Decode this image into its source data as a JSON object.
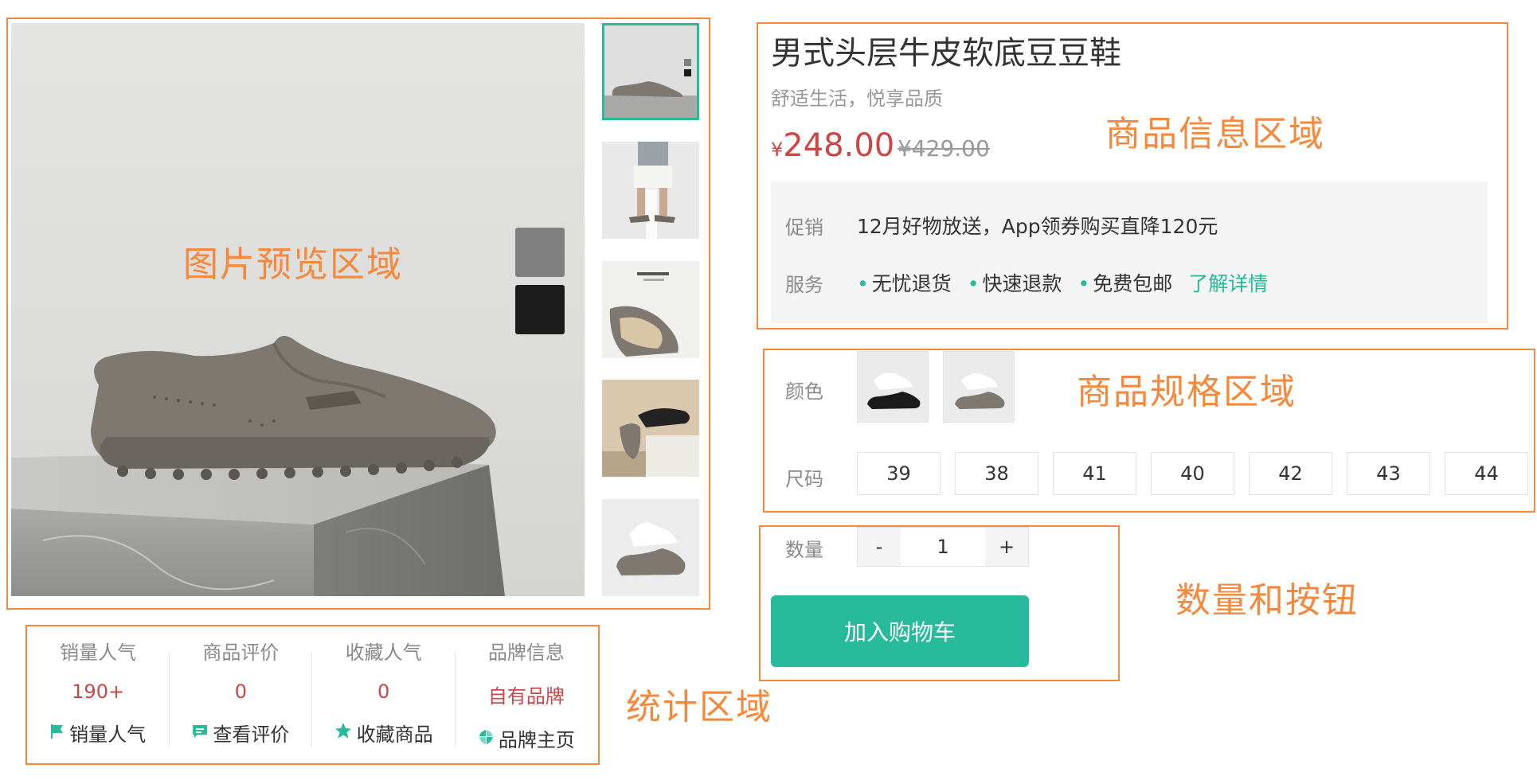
{
  "preview": {
    "annotation": "图片预览区域"
  },
  "info": {
    "title": "男式头层牛皮软底豆豆鞋",
    "subtitle": "舒适生活，悦享品质",
    "price_symbol": "¥",
    "price": "248.00",
    "old_price": "¥429.00",
    "annotation": "商品信息区域",
    "promo_label": "促销",
    "promo_text": "12月好物放送，App领券购买直降120元",
    "service_label": "服务",
    "services": [
      "无忧退货",
      "快速退款",
      "免费包邮"
    ],
    "service_link": "了解详情"
  },
  "spec": {
    "annotation": "商品规格区域",
    "color_label": "颜色",
    "size_label": "尺码",
    "sizes": [
      "39",
      "38",
      "41",
      "40",
      "42",
      "43",
      "44"
    ]
  },
  "quantity": {
    "annotation": "数量和按钮",
    "label": "数量",
    "minus": "-",
    "value": "1",
    "plus": "+",
    "cart_button": "加入购物车"
  },
  "stats": {
    "annotation": "统计区域",
    "columns": [
      {
        "title": "销量人气",
        "value": "190+",
        "action": "销量人气",
        "icon": "flag-icon"
      },
      {
        "title": "商品评价",
        "value": "0",
        "action": "查看评价",
        "icon": "comment-icon"
      },
      {
        "title": "收藏人气",
        "value": "0",
        "action": "收藏商品",
        "icon": "star-icon"
      },
      {
        "title": "品牌信息",
        "value": "自有品牌",
        "action": "品牌主页",
        "icon": "brand-icon"
      }
    ]
  },
  "colors": {
    "accent": "#27ba9b",
    "price": "#cf4444",
    "annotation": "#f5883b"
  }
}
